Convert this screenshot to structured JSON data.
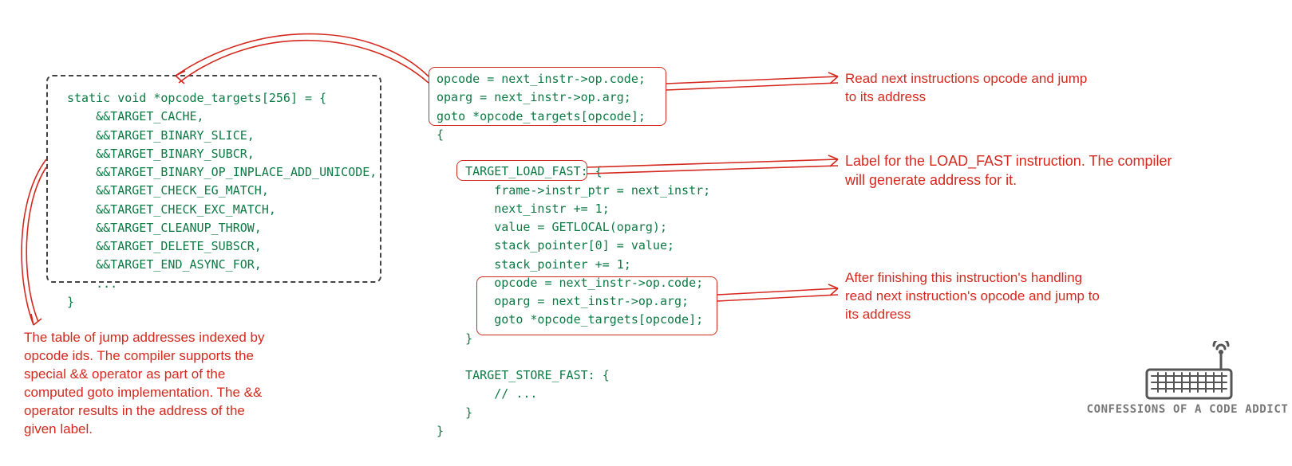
{
  "left_code": "static void *opcode_targets[256] = {\n    &&TARGET_CACHE,\n    &&TARGET_BINARY_SLICE,\n    &&TARGET_BINARY_SUBCR,\n    &&TARGET_BINARY_OP_INPLACE_ADD_UNICODE,\n    &&TARGET_CHECK_EG_MATCH,\n    &&TARGET_CHECK_EXC_MATCH,\n    &&TARGET_CLEANUP_THROW,\n    &&TARGET_DELETE_SUBSCR,\n    &&TARGET_END_ASYNC_FOR,\n    ...\n}",
  "right_code": "opcode = next_instr->op.code;\noparg = next_instr->op.arg;\ngoto *opcode_targets[opcode];\n{\n\n    TARGET_LOAD_FAST: {\n        frame->instr_ptr = next_instr;\n        next_instr += 1;\n        value = GETLOCAL(oparg);\n        stack_pointer[0] = value;\n        stack_pointer += 1;\n        opcode = next_instr->op.code;\n        oparg = next_instr->op.arg;\n        goto *opcode_targets[opcode];\n    }\n\n    TARGET_STORE_FAST: {\n        // ...\n    }\n}",
  "anno_left": "The table of jump addresses indexed by\nopcode ids. The compiler supports the\nspecial && operator as part of the\ncomputed goto implementation. The &&\noperator results in the address of the\ngiven label.",
  "anno_read": "Read next instructions opcode and jump\nto its address",
  "anno_label": "Label for the LOAD_FAST instruction. The compiler\nwill generate address for it.",
  "anno_after": "After finishing this instruction's handling\nread next instruction's opcode and jump to\nits address",
  "brand": "CONFESSIONS OF A CODE ADDICT"
}
